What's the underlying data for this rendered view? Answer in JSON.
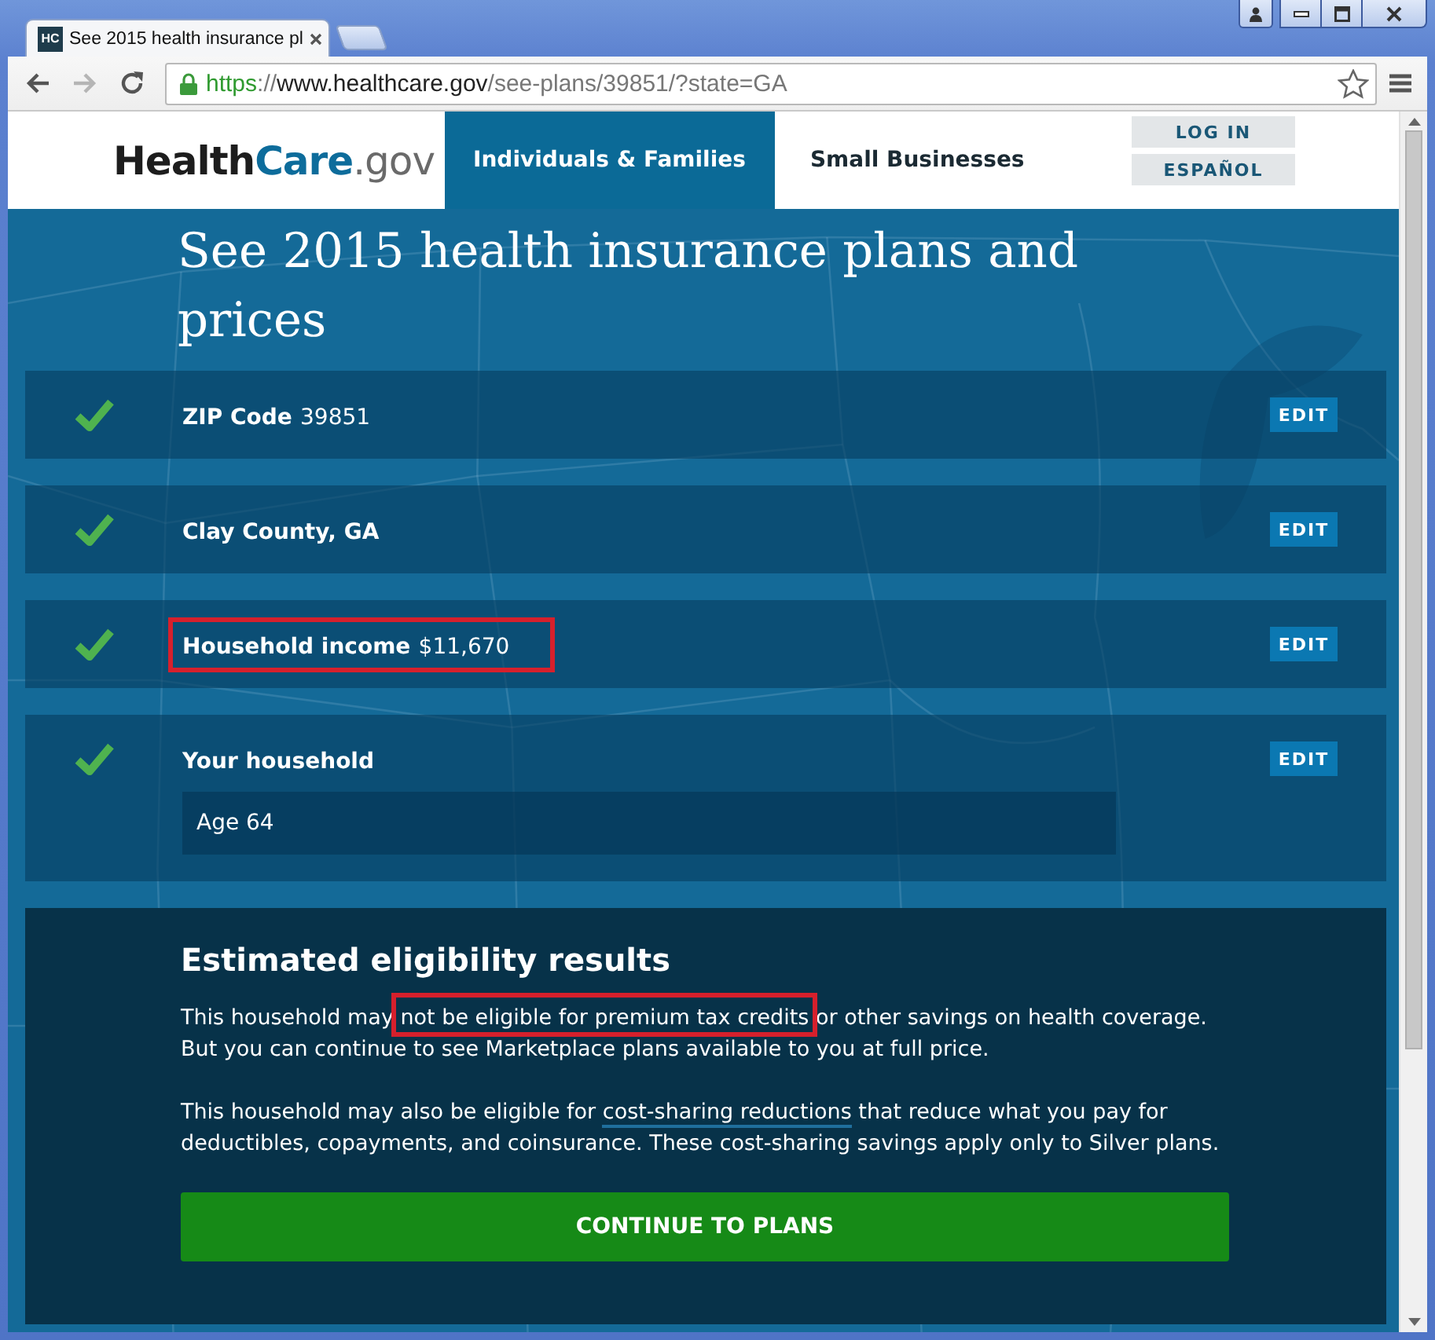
{
  "browser": {
    "tab": {
      "favicon": "HC",
      "title": "See 2015 health insurance pl"
    },
    "url": "https://www.healthcare.gov/see-plans/39851/?state=GA"
  },
  "header": {
    "logo": [
      "Health",
      "Care",
      ".gov"
    ],
    "nav": [
      {
        "label": "Individuals & Families",
        "selected": true
      },
      {
        "label": "Small Businesses",
        "selected": false
      }
    ],
    "account_links": [
      "LOG IN",
      "ESPAÑOL"
    ]
  },
  "page": {
    "title": "See 2015 health insurance plans and prices",
    "steps": [
      {
        "label": "ZIP Code",
        "value": "39851",
        "complete": true,
        "highlighted": false,
        "action": "EDIT"
      },
      {
        "label": "Clay County, GA",
        "complete": true,
        "highlighted": false,
        "action": "EDIT"
      },
      {
        "label": "Household income",
        "value": "$11,670",
        "complete": true,
        "highlighted": true,
        "action": "EDIT"
      },
      {
        "label": "Your household",
        "members": [
          "Age 64"
        ],
        "complete": true,
        "highlighted": false,
        "action": "EDIT"
      }
    ],
    "results": {
      "title": "Estimated eligibility results",
      "paragraphs": [
        [
          {
            "kind": "text",
            "text": "This household may "
          },
          {
            "kind": "marked",
            "text": "not be eligible for premium tax credits"
          },
          {
            "kind": "text",
            "text": " or other savings on health coverage. But you can continue to see Marketplace plans available to you at full price."
          }
        ],
        [
          {
            "kind": "text",
            "text": "This household may also be eligible for "
          },
          {
            "kind": "link",
            "text": "cost-sharing reductions"
          },
          {
            "kind": "text",
            "text": " that reduce what you pay for deductibles, copayments, and coinsurance. These cost-sharing savings apply only to Silver plans."
          }
        ]
      ],
      "button": "CONTINUE TO PLANS"
    }
  }
}
